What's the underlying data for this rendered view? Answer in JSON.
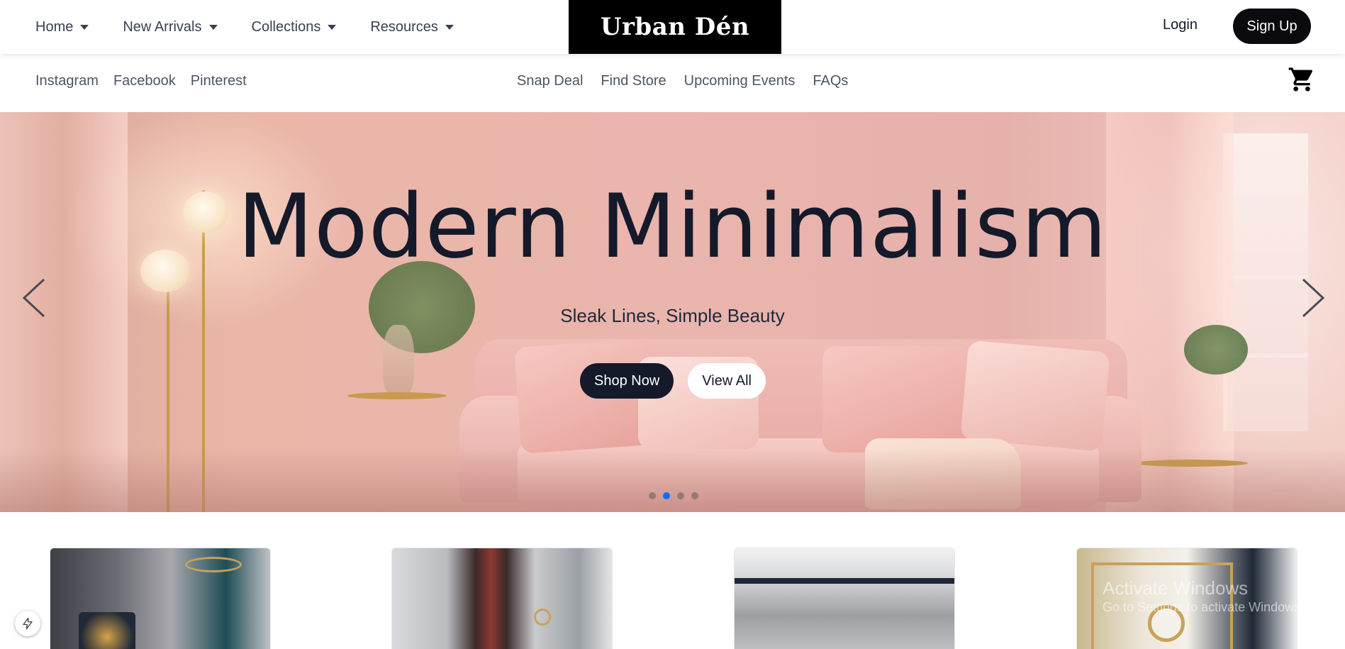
{
  "topnav": {
    "menu": [
      {
        "label": "Home"
      },
      {
        "label": "New Arrivals"
      },
      {
        "label": "Collections"
      },
      {
        "label": "Resources"
      }
    ],
    "logo": "Urban Dén",
    "login_label": "Login",
    "signup_label": "Sign Up"
  },
  "subnav": {
    "social": [
      "Instagram",
      "Facebook",
      "Pinterest"
    ],
    "links": [
      "Snap Deal",
      "Find Store",
      "Upcoming Events",
      "FAQs"
    ],
    "cart_icon": "shopping-cart-icon"
  },
  "hero": {
    "title": "Modern Minimalism",
    "subtitle": "Sleak Lines, Simple Beauty",
    "primary_button": "Shop Now",
    "secondary_button": "View All",
    "slide_count": 4,
    "active_slide": 2
  },
  "cards": [
    {
      "name": "product-card-1"
    },
    {
      "name": "product-card-2"
    },
    {
      "name": "product-card-3"
    },
    {
      "name": "product-card-4"
    }
  ],
  "watermark": {
    "line1": "Activate Windows",
    "line2": "Go to Settings to activate Windows."
  },
  "colors": {
    "accent": "#0d6efd",
    "dark": "#141a2a",
    "logo_bg": "#000000"
  }
}
